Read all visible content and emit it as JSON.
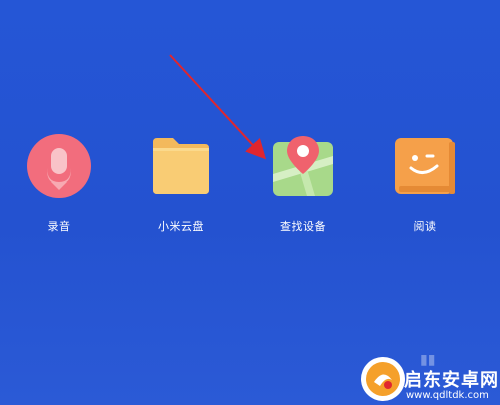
{
  "apps": [
    {
      "label": "录音",
      "icon": "microphone-icon",
      "color": "#f26d7d"
    },
    {
      "label": "小米云盘",
      "icon": "folder-icon",
      "color": "#f9cc74"
    },
    {
      "label": "查找设备",
      "icon": "map-pin-icon",
      "color": "#a8d98a"
    },
    {
      "label": "阅读",
      "icon": "smile-book-icon",
      "color": "#f5a04a"
    }
  ],
  "annotation": {
    "arrow_color": "#e0262e",
    "target": "查找设备"
  },
  "watermark": {
    "title": "启东安卓网",
    "url": "www.qdltdk.com"
  },
  "colors": {
    "background": "#2556d6"
  }
}
